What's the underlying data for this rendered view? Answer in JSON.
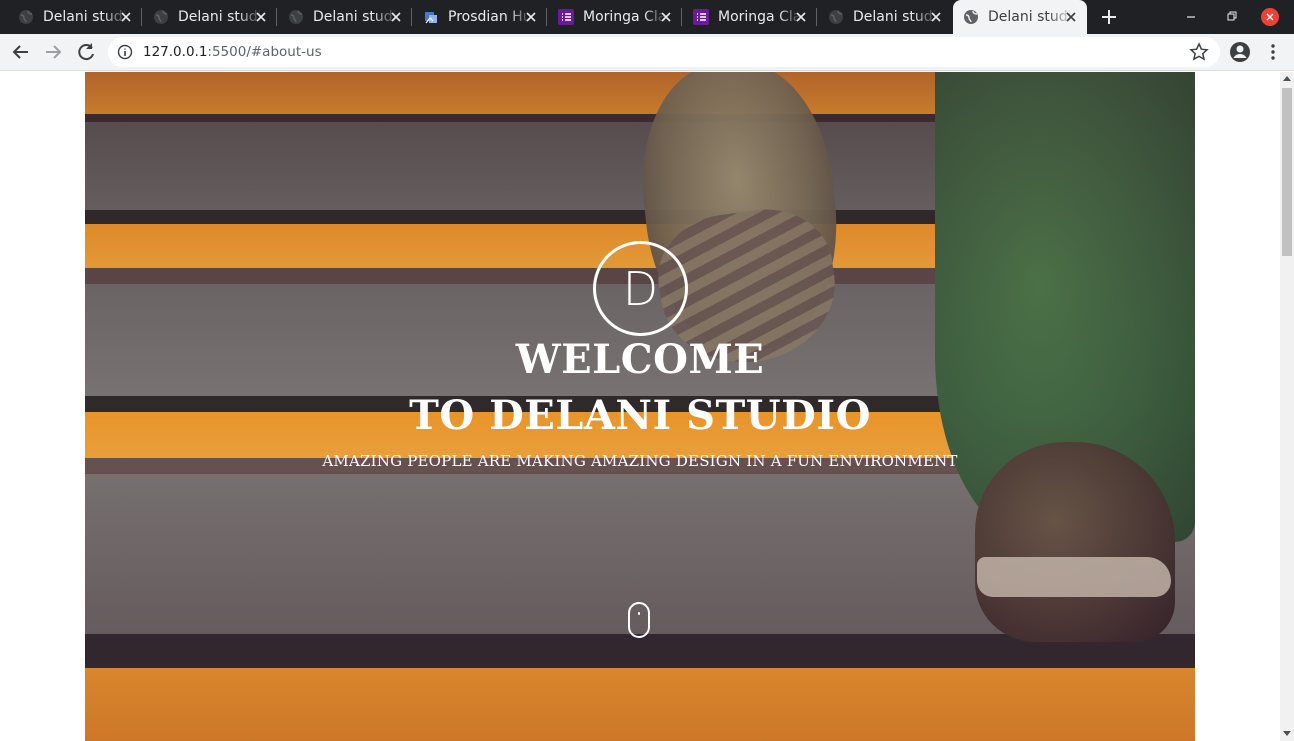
{
  "browser": {
    "tabs": [
      {
        "title": "Delani studio",
        "icon": "globe-icon",
        "active": false
      },
      {
        "title": "Delani studio",
        "icon": "globe-icon",
        "active": false
      },
      {
        "title": "Delani studio",
        "icon": "globe-icon",
        "active": false
      },
      {
        "title": "Prosdian Hub",
        "icon": "prosdian-icon",
        "active": false
      },
      {
        "title": "Moringa Classroom",
        "icon": "list-icon",
        "active": false
      },
      {
        "title": "Moringa Classroom",
        "icon": "list-icon",
        "active": false
      },
      {
        "title": "Delani studio",
        "icon": "globe-icon",
        "active": false
      },
      {
        "title": "Delani studio",
        "icon": "globe-icon",
        "active": true
      }
    ],
    "url_host": "127.0.0.1",
    "url_rest": ":5500/#about-us",
    "colors": {
      "tabstrip": "#202124",
      "toolbar": "#f1f3f4",
      "close_button": "#ea4335",
      "moringa_icon": "#6a1b9a"
    }
  },
  "hero": {
    "logo_letter": "D",
    "headline_line1": "WELCOME",
    "headline_line2": "TO DELANI STUDIO",
    "tagline": "AMAZING PEOPLE ARE MAKING AMAZING DESIGN IN A FUN ENVIRONMENT",
    "scroll_indicator": "mouse-scroll-icon",
    "colors": {
      "stripe_orange": "#f29a2a",
      "stripe_dark": "#2e2a2c",
      "pants_green": "#3d6140"
    }
  }
}
